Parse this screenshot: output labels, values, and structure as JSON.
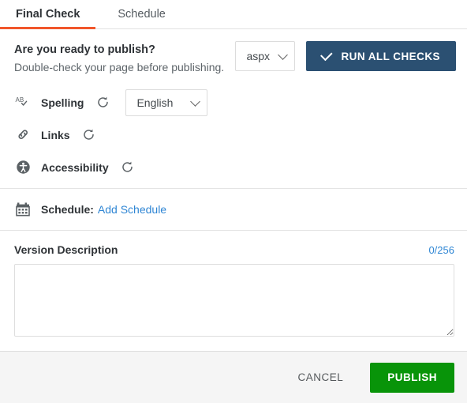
{
  "tabs": [
    {
      "label": "Final Check",
      "active": true
    },
    {
      "label": "Schedule",
      "active": false
    }
  ],
  "intro": {
    "title": "Are you ready to publish?",
    "subtitle": "Double-check your page before publishing.",
    "format_select": {
      "value": "aspx",
      "icon": "chevron-down-icon"
    },
    "run_button": {
      "label": "RUN ALL CHECKS",
      "icon": "check-icon"
    }
  },
  "checks": [
    {
      "name": "Spelling",
      "icon": "spellcheck-icon",
      "refresh_icon": "refresh-icon",
      "language_select": {
        "value": "English",
        "icon": "chevron-down-icon"
      }
    },
    {
      "name": "Links",
      "icon": "link-icon",
      "refresh_icon": "refresh-icon"
    },
    {
      "name": "Accessibility",
      "icon": "accessibility-icon",
      "refresh_icon": "refresh-icon"
    }
  ],
  "schedule": {
    "icon": "calendar-icon",
    "label": "Schedule:",
    "link_label": "Add Schedule"
  },
  "version": {
    "title": "Version Description",
    "counter": "0/256",
    "value": "",
    "placeholder": ""
  },
  "footer": {
    "cancel_label": "CANCEL",
    "publish_label": "PUBLISH"
  },
  "colors": {
    "tab_accent": "#f1562b",
    "run_button": "#2b5072",
    "publish_button": "#089409",
    "link": "#2f86d4",
    "footer_bg": "#f5f5f5"
  }
}
